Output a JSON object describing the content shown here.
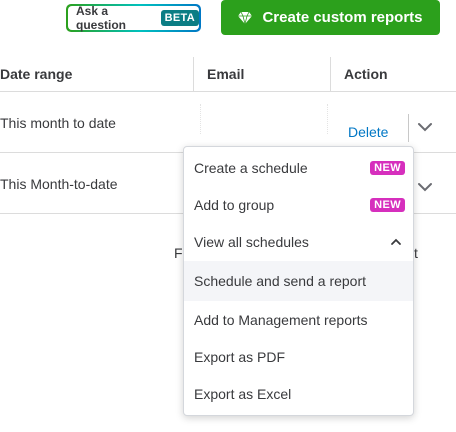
{
  "header": {
    "ask_label": "Ask a question",
    "beta_badge": "BETA",
    "create_label": "Create custom reports",
    "create_icon": "diamond-icon",
    "brand_green": "#2ca01c"
  },
  "table": {
    "columns": [
      "Date range",
      "Email",
      "Action"
    ],
    "rows": [
      {
        "date_range": "This month to date",
        "email": "",
        "action": "Delete"
      },
      {
        "date_range": "This Month-to-date",
        "email": "",
        "action": ""
      }
    ]
  },
  "background_fragments": {
    "left": "F",
    "right": "t"
  },
  "menu": {
    "items": [
      {
        "label": "Create a schedule",
        "badge": "NEW"
      },
      {
        "label": "Add to group",
        "badge": "NEW"
      },
      {
        "label": "View all schedules",
        "icon": "chevron-up-icon"
      },
      {
        "label": "Schedule and send a report",
        "state": "hovered"
      },
      {
        "label": "Add to Management reports"
      },
      {
        "label": "Export as PDF"
      },
      {
        "label": "Export as Excel"
      }
    ],
    "badge_color": "#d62fbd"
  }
}
